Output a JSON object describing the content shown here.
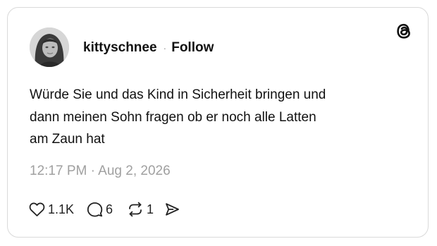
{
  "post": {
    "username": "kittyschnee",
    "separator": "·",
    "follow_label": "Follow",
    "text": "Würde Sie und das Kind in Sicherheit bringen und\ndann meinen Sohn fragen ob er noch alle Latten\nam Zaun hat",
    "timestamp": "12:17 PM · Aug 2, 2026",
    "likes": "1.1K",
    "replies": "6",
    "reposts": "1"
  },
  "icons": {
    "brand": "threads-logo-icon",
    "like": "heart-icon",
    "reply": "speech-bubble-icon",
    "repost": "repost-arrows-icon",
    "share": "send-icon"
  },
  "colors": {
    "text": "#111111",
    "muted": "#a0a0a0",
    "border": "#d9d9d9"
  }
}
